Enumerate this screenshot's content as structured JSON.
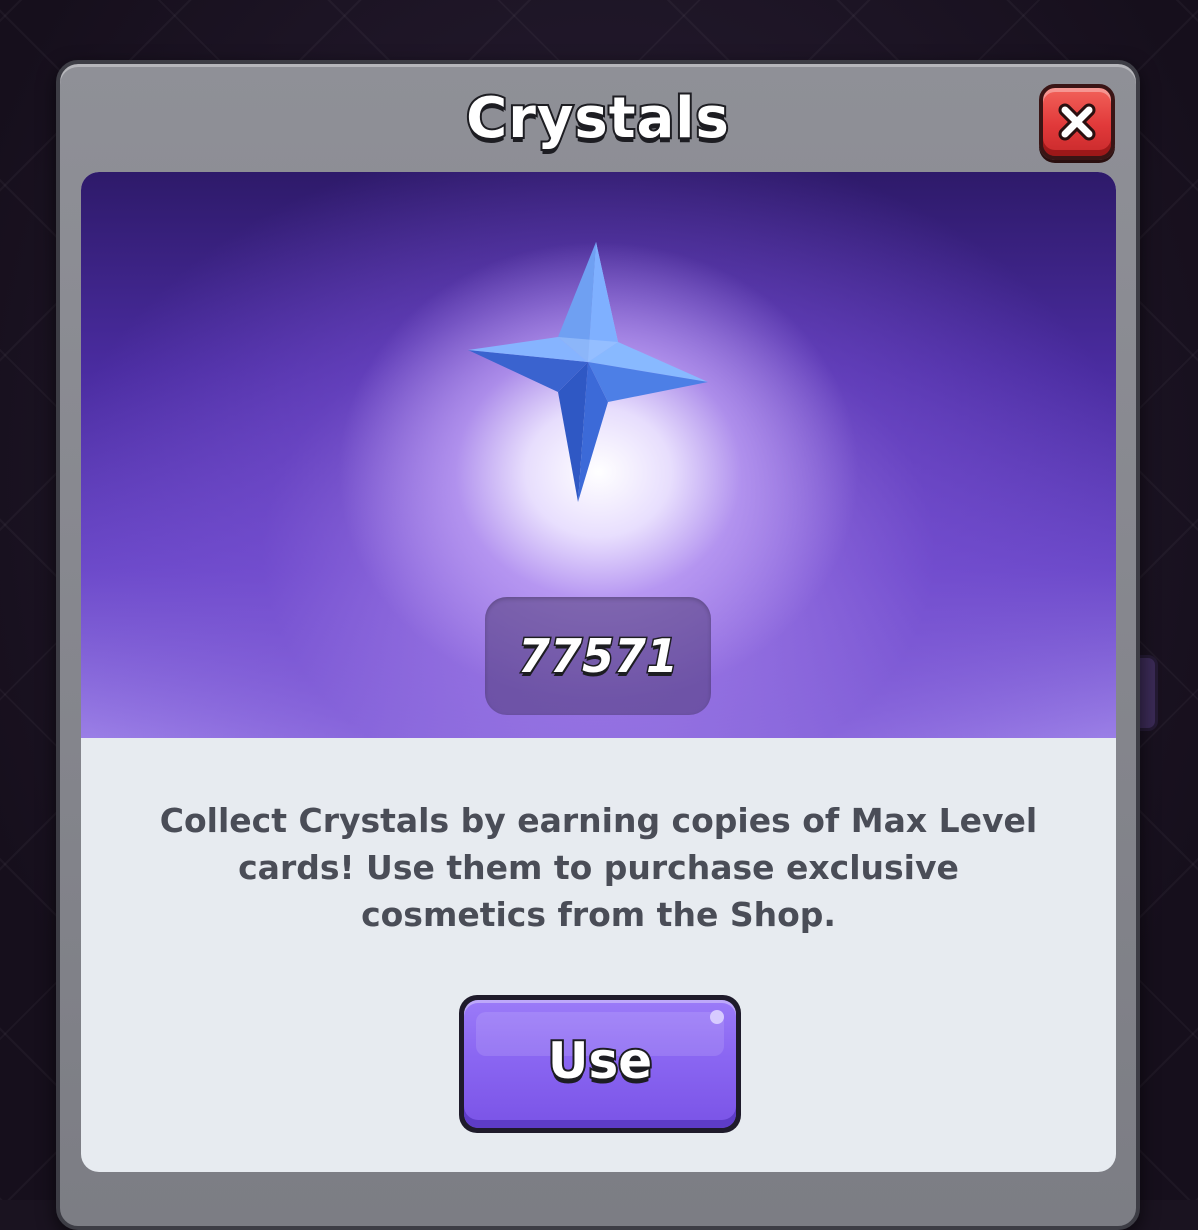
{
  "dialog": {
    "title": "Crystals",
    "close_icon": "close-icon",
    "currency_icon": "crystal-icon",
    "crystal_count": "77571",
    "description": "Collect Crystals by earning copies of Max Level cards! Use them to purchase exclusive cosmetics from the Shop.",
    "use_label": "Use"
  },
  "colors": {
    "close_button": "#e1393a",
    "use_button": "#8a66f2",
    "hero_top": "#2e1a6a",
    "crystal": "#5f8ff0"
  }
}
